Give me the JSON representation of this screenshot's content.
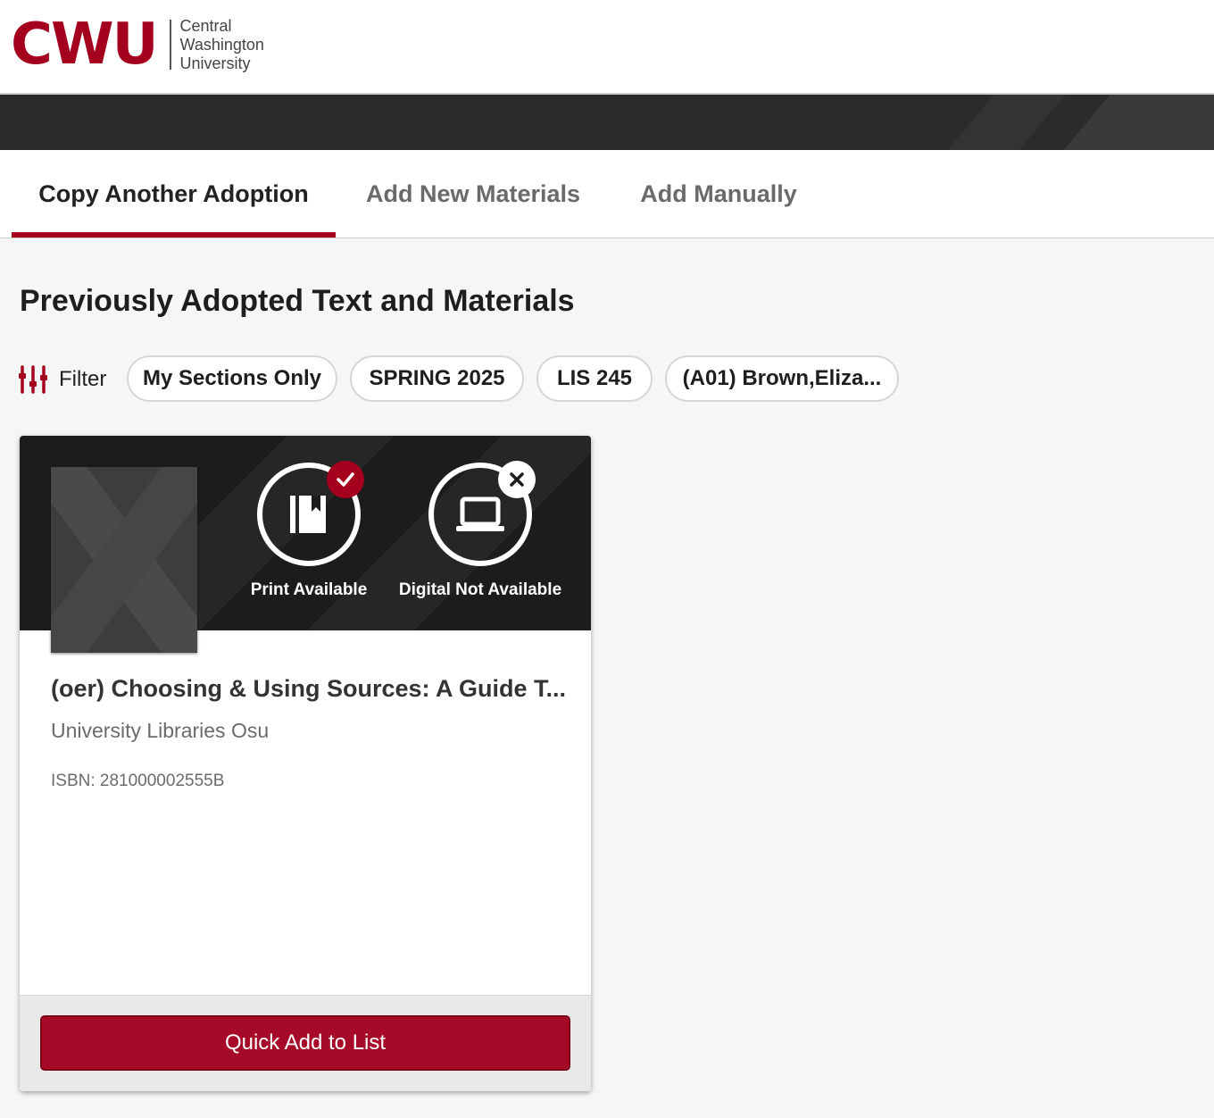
{
  "header": {
    "logo_mark": "CWU",
    "logo_line1": "Central",
    "logo_line2": "Washington",
    "logo_line3": "University",
    "brand_color": "#a4001e"
  },
  "tabs": [
    {
      "label": "Copy Another Adoption",
      "active": true
    },
    {
      "label": "Add New Materials",
      "active": false
    },
    {
      "label": "Add Manually",
      "active": false
    }
  ],
  "page_title": "Previously Adopted Text and Materials",
  "filter": {
    "label": "Filter",
    "icon": "sliders-icon",
    "chips": [
      "My Sections Only",
      "SPRING 2025",
      "LIS 245",
      "(A01) Brown,Eliza..."
    ]
  },
  "card": {
    "print_status": "Print Available",
    "print_icon": "book-icon",
    "print_badge": "check-icon",
    "digital_status": "Digital Not Available",
    "digital_icon": "laptop-icon",
    "digital_badge": "close-icon",
    "title": "(oer) Choosing & Using Sources: A Guide T...",
    "author": "University Libraries Osu",
    "isbn": "ISBN: 281000002555B",
    "button_label": "Quick Add to List"
  }
}
